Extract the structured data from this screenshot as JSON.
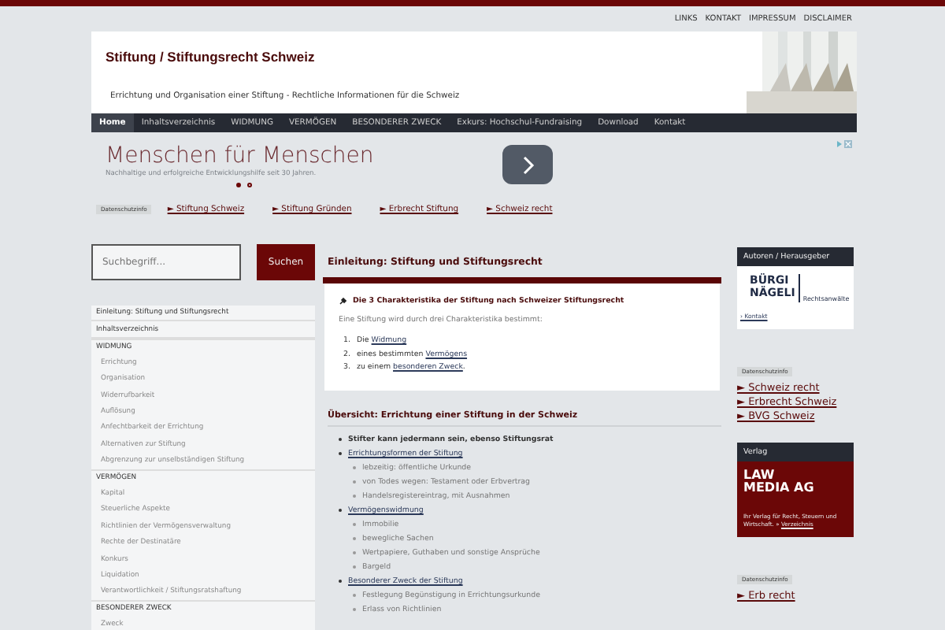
{
  "top_links": [
    "LINKS",
    "KONTAKT",
    "IMPRESSUM",
    "DISCLAIMER"
  ],
  "header": {
    "title": "Stiftung / Stiftungsrecht Schweiz",
    "subtitle": "Errichtung und Organisation einer Stiftung - Rechtliche Informationen für die Schweiz"
  },
  "nav": [
    {
      "label": "Home",
      "selected": true
    },
    {
      "label": "Inhaltsverzeichnis",
      "selected": false
    },
    {
      "label": "WIDMUNG",
      "selected": false
    },
    {
      "label": "VERMÖGEN",
      "selected": false
    },
    {
      "label": "BESONDERER ZWECK",
      "selected": false
    },
    {
      "label": "Exkurs: Hochschul-Fundraising",
      "selected": false
    },
    {
      "label": "Download",
      "selected": false
    },
    {
      "label": "Kontakt",
      "selected": false
    }
  ],
  "ad": {
    "headline": "Menschen für Menschen",
    "subline": "Nachhaltige und erfolgreiche Entwicklungshilfe seit 30 Jahren.",
    "dots": [
      {
        "selected": true
      },
      {
        "selected": false
      }
    ]
  },
  "ad_links": {
    "badge": "Datenschutzinfo",
    "links": [
      "► Stiftung Schweiz",
      "► Stiftung Gründen",
      "► Erbrecht Stiftung",
      "► Schweiz recht"
    ]
  },
  "search": {
    "placeholder": "Suchbegriff...",
    "button": "Suchen"
  },
  "sidebar": [
    {
      "label": "Einleitung: Stiftung und Stiftungsrecht",
      "kind": "top"
    },
    {
      "label": "Inhaltsverzeichnis",
      "kind": "top"
    },
    {
      "label": "WIDMUNG",
      "kind": "section"
    },
    {
      "label": "Errichtung",
      "kind": "sub"
    },
    {
      "label": "Organisation",
      "kind": "sub"
    },
    {
      "label": "Widerrufbarkeit",
      "kind": "sub"
    },
    {
      "label": "Auflösung",
      "kind": "sub"
    },
    {
      "label": "Anfechtbarkeit der Errichtung",
      "kind": "sub"
    },
    {
      "label": "Alternativen zur Stiftung",
      "kind": "sub"
    },
    {
      "label": "Abgrenzung zur unselbständigen Stiftung",
      "kind": "sub"
    },
    {
      "label": "VERMÖGEN",
      "kind": "section"
    },
    {
      "label": "Kapital",
      "kind": "sub"
    },
    {
      "label": "Steuerliche Aspekte",
      "kind": "sub"
    },
    {
      "label": "Richtlinien der Vermögensverwaltung",
      "kind": "sub"
    },
    {
      "label": "Rechte der Destinatäre",
      "kind": "sub"
    },
    {
      "label": "Konkurs",
      "kind": "sub"
    },
    {
      "label": "Liquidation",
      "kind": "sub"
    },
    {
      "label": "Verantwortlichkeit / Stiftungsratshaftung",
      "kind": "sub"
    },
    {
      "label": "BESONDERER ZWECK",
      "kind": "section"
    },
    {
      "label": "Zweck",
      "kind": "sub"
    }
  ],
  "intro": {
    "title": "Einleitung: Stiftung und Stiftungsrecht",
    "heading": "Die 3 Charakteristika der Stiftung nach Schweizer Stiftungsrecht",
    "text": "Eine Stiftung wird durch drei Charakteristika bestimmt:",
    "list": [
      {
        "number": "1.",
        "prefix": "Die",
        "link": "Widmung"
      },
      {
        "number": "2.",
        "prefix": "eines bestimmten",
        "link": "Vermögens"
      },
      {
        "number": "3.",
        "prefix": "zu einem",
        "link": "besonderen Zweck",
        "suffix": "."
      }
    ]
  },
  "overview": {
    "title": "Übersicht: Errichtung einer Stiftung in der Schweiz",
    "items": [
      {
        "label": "Stifter kann jedermann sein, ebenso Stiftungsrat",
        "kind": "text"
      },
      {
        "label": "Errichtungsformen der Stiftung",
        "kind": "link",
        "children": [
          "lebzeitig: öffentliche Urkunde",
          "von Todes wegen: Testament oder Erbvertrag",
          "Handelsregistereintrag, mit Ausnahmen"
        ]
      },
      {
        "label": "Vermögenswidmung",
        "kind": "link",
        "children": [
          "Immobilie",
          "bewegliche Sachen",
          "Wertpapiere, Guthaben und sonstige Ansprüche",
          "Bargeld"
        ]
      },
      {
        "label": "Besonderer Zweck der Stiftung",
        "kind": "link",
        "children": [
          "Festlegung Begünstigung in Errichtungsurkunde",
          "Erlass von Richtlinien"
        ]
      }
    ]
  },
  "authors": {
    "title": "Autoren / Herausgeber",
    "logo": [
      "BÜRGI",
      "NÄGELI"
    ],
    "logo_tag": "Rechtsanwälte",
    "link": "› Kontakt"
  },
  "right_ads": {
    "badge": "Datenschutzinfo",
    "links": [
      "► Schweiz recht",
      "► Erbrecht Schweiz",
      "► BVG Schweiz"
    ]
  },
  "publisher": {
    "title": "Verlag",
    "name": [
      "LAW",
      "MEDIA AG"
    ],
    "text": "Ihr Verlag für Recht, Steuern und Wirtschaft. »",
    "link": "Verzeichnis"
  },
  "right_ads_2": {
    "badge": "Datenschutzinfo",
    "links": [
      "► Erb recht"
    ]
  }
}
